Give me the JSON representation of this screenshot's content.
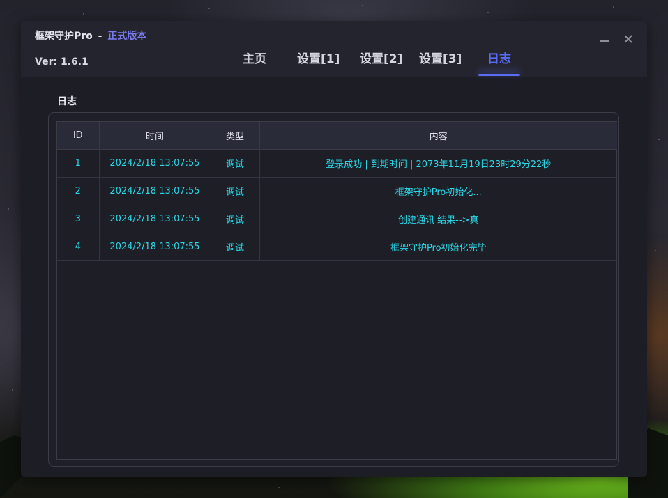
{
  "app": {
    "title": "框架守护Pro",
    "separator": "-",
    "edition": "正式版本",
    "version": "Ver: 1.6.1"
  },
  "nav": {
    "tabs": [
      {
        "label": "主页"
      },
      {
        "label": "设置[1]"
      },
      {
        "label": "设置[2]"
      },
      {
        "label": "设置[3]"
      },
      {
        "label": "日志"
      }
    ],
    "active_index": 4
  },
  "window_controls": {
    "minimize_icon": "minimize-icon",
    "close_icon": "close-icon",
    "minimize_glyph": "—",
    "close_glyph": "✕"
  },
  "log": {
    "section_title": "日志",
    "columns": [
      "ID",
      "时间",
      "类型",
      "内容"
    ],
    "rows": [
      [
        "1",
        "2024/2/18 13:07:55",
        "调试",
        "登录成功 | 到期时间 | 2073年11月19日23时29分22秒"
      ],
      [
        "2",
        "2024/2/18 13:07:55",
        "调试",
        "框架守护Pro初始化..."
      ],
      [
        "3",
        "2024/2/18 13:07:55",
        "调试",
        "创建通讯 结果-->真"
      ],
      [
        "4",
        "2024/2/18 13:07:55",
        "调试",
        "框架守护Pro初始化完毕"
      ]
    ]
  },
  "colors": {
    "accent": "#5a6cf5",
    "edition": "#7b7bf0",
    "cell_text": "#2ad8e6",
    "window_bg": "#1d1d25"
  }
}
